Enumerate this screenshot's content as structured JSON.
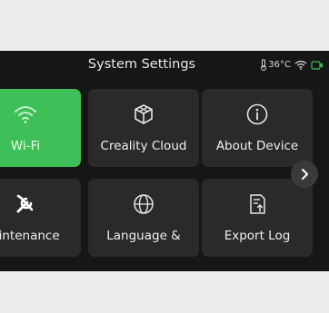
{
  "header": {
    "title": "System Settings",
    "temperature": "36°C",
    "icons": [
      "thermometer-icon",
      "wifi-icon",
      "camera-status-icon"
    ]
  },
  "tiles": [
    {
      "label": "Wi-Fi",
      "icon": "wifi-icon",
      "active": true
    },
    {
      "label": "Creality Cloud",
      "icon": "cloud-cube-icon",
      "active": false
    },
    {
      "label": "About Device",
      "icon": "info-icon",
      "active": false
    },
    {
      "label": "aintenance",
      "icon": "tools-icon",
      "active": false
    },
    {
      "label": "Language &",
      "icon": "globe-icon",
      "active": false
    },
    {
      "label": "Export Log",
      "icon": "export-log-icon",
      "active": false
    }
  ],
  "colors": {
    "accent": "#3fbf58",
    "tile": "#2a2a2a",
    "screen": "#161616",
    "background": "#ededed"
  }
}
